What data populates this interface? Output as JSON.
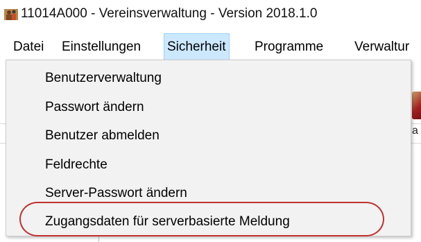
{
  "window": {
    "title": "11014A000 - Vereinsverwaltung - Version 2018.1.0",
    "icon": "people-app-icon"
  },
  "menubar": {
    "items": [
      {
        "label": "Datei",
        "active": false
      },
      {
        "label": "Einstellungen",
        "active": false
      },
      {
        "label": "Sicherheit",
        "active": true
      },
      {
        "label": "Programme",
        "active": false
      },
      {
        "label": "Verwaltur",
        "active": false
      }
    ]
  },
  "dropdown": {
    "items": [
      {
        "label": "Benutzerverwaltung"
      },
      {
        "label": "Passwort ändern"
      },
      {
        "label": "Benutzer abmelden"
      },
      {
        "label": "Feldrechte"
      },
      {
        "label": "Server-Passwort ändern"
      },
      {
        "label": "Zugangsdaten für serverbasierte Meldung",
        "highlighted": true
      }
    ]
  },
  "background": {
    "partial_letter": "a"
  },
  "colors": {
    "menu_active_bg": "#cce8ff",
    "menu_active_border": "#99d1ff",
    "dropdown_bg": "#f2f2f2",
    "annotation_red": "#c0312f"
  }
}
